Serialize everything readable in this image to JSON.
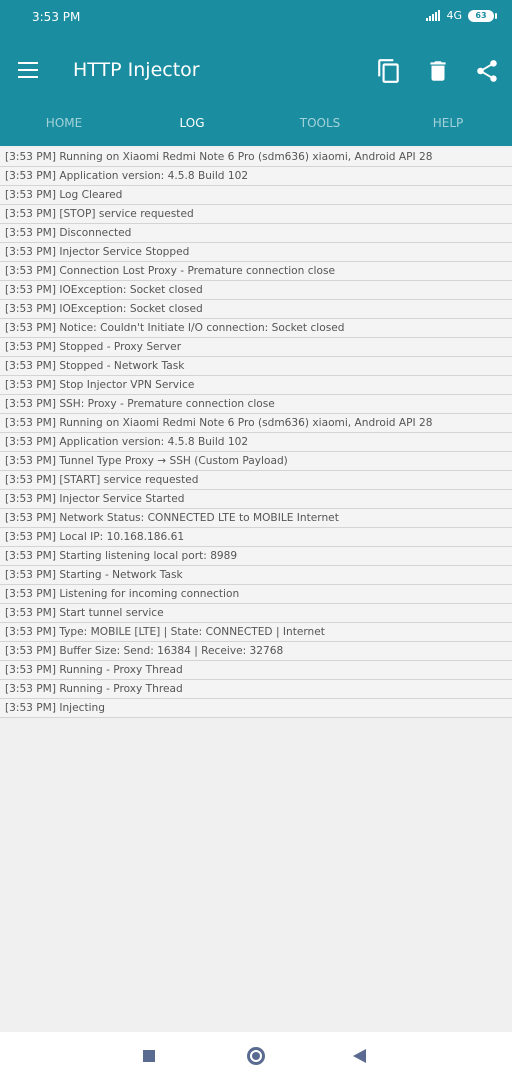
{
  "status_bar": {
    "time": "3:53 PM",
    "network": "4G",
    "battery": "63"
  },
  "toolbar": {
    "title": "HTTP Injector",
    "icons": [
      "menu-icon",
      "copy-icon",
      "delete-icon",
      "share-icon"
    ]
  },
  "tabs": [
    {
      "label": "HOME",
      "active": false
    },
    {
      "label": "LOG",
      "active": true
    },
    {
      "label": "TOOLS",
      "active": false
    },
    {
      "label": "HELP",
      "active": false
    }
  ],
  "log": [
    "[3:53 PM] Running on Xiaomi Redmi Note 6 Pro (sdm636) xiaomi, Android API 28",
    "[3:53 PM] Application version: 4.5.8 Build 102",
    "[3:53 PM] Log Cleared",
    "[3:53 PM] [STOP] service requested",
    "[3:53 PM] Disconnected",
    "[3:53 PM] Injector Service Stopped",
    "[3:53 PM] Connection Lost Proxy - Premature connection close",
    "[3:53 PM] IOException: Socket closed",
    "[3:53 PM] IOException: Socket closed",
    "[3:53 PM] Notice: Couldn't Initiate I/O connection: Socket closed",
    "[3:53 PM] Stopped - Proxy Server",
    "[3:53 PM] Stopped - Network Task",
    "[3:53 PM] Stop Injector VPN Service",
    "[3:53 PM] SSH: Proxy - Premature connection close",
    "[3:53 PM] Running on Xiaomi Redmi Note 6 Pro (sdm636) xiaomi, Android API 28",
    "[3:53 PM] Application version: 4.5.8 Build 102",
    "[3:53 PM] Tunnel Type Proxy → SSH (Custom Payload)",
    "[3:53 PM] [START] service requested",
    "[3:53 PM] Injector Service Started",
    "[3:53 PM] Network Status: CONNECTED LTE to MOBILE Internet",
    "[3:53 PM] Local IP: 10.168.186.61",
    "[3:53 PM] Starting listening local port: 8989",
    "[3:53 PM] Starting - Network Task",
    "[3:53 PM] Listening for incoming connection",
    "[3:53 PM] Start tunnel service",
    "[3:53 PM] Type: MOBILE [LTE] | State: CONNECTED | Internet",
    "[3:53 PM] Buffer Size: Send: 16384 | Receive: 32768",
    "[3:53 PM] Running - Proxy Thread",
    "[3:53 PM] Running - Proxy Thread",
    "[3:53 PM] Injecting"
  ],
  "colors": {
    "primary": "#1a8da0",
    "nav_icon": "#5a6a90",
    "background": "#f0f0f0"
  }
}
